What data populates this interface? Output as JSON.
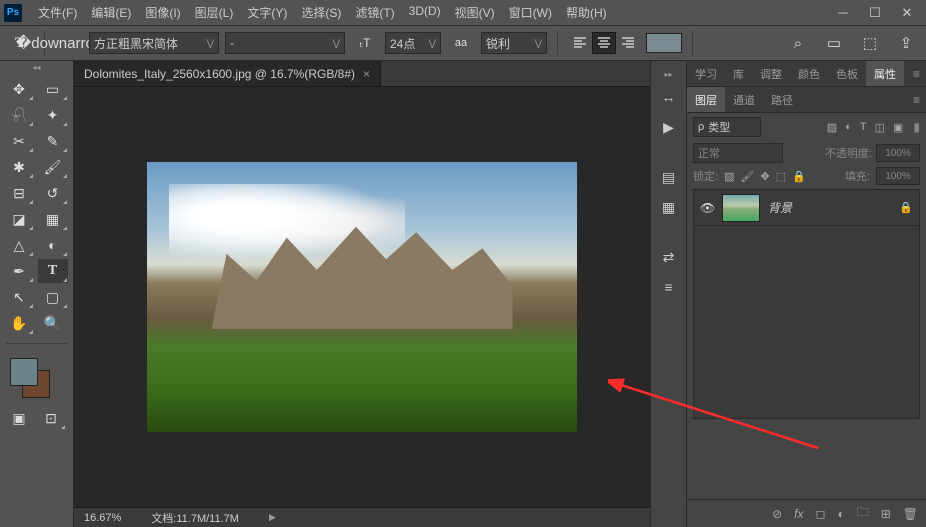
{
  "app": {
    "logo": "Ps"
  },
  "menu": {
    "file": "文件(F)",
    "edit": "编辑(E)",
    "image": "图像(I)",
    "layer": "图层(L)",
    "type": "文字(Y)",
    "select": "选择(S)",
    "filter": "滤镜(T)",
    "threed": "3D(D)",
    "view": "视图(V)",
    "window": "窗口(W)",
    "help": "帮助(H)"
  },
  "options": {
    "fontFamily": "方正粗黑宋简体",
    "fontStyle": "-",
    "fontSizeLabel": "24点",
    "aaLabel": "aa",
    "aaMode": "锐利",
    "colorSwatch": "#7a8a92"
  },
  "document": {
    "tab": "Dolomites_Italy_2560x1600.jpg @ 16.7%(RGB/8#)",
    "zoom": "16.67%",
    "docInfo": "文档:11.7M/11.7M"
  },
  "propsTabs": {
    "study": "学习",
    "lib": "库",
    "adjust": "调整",
    "color": "颜色",
    "swatch": "色板",
    "props": "属性"
  },
  "layersTabs": {
    "layers": "图层",
    "channels": "通道",
    "paths": "路径"
  },
  "layersPanel": {
    "filterKind": "类型",
    "filterKindIcon": "ρ",
    "blendMode": "正常",
    "opacityLabel": "不透明度:",
    "opacityValue": "100%",
    "lockLabel": "锁定:",
    "fillLabel": "填充:",
    "fillValue": "100%",
    "bgLayerName": "背景"
  }
}
